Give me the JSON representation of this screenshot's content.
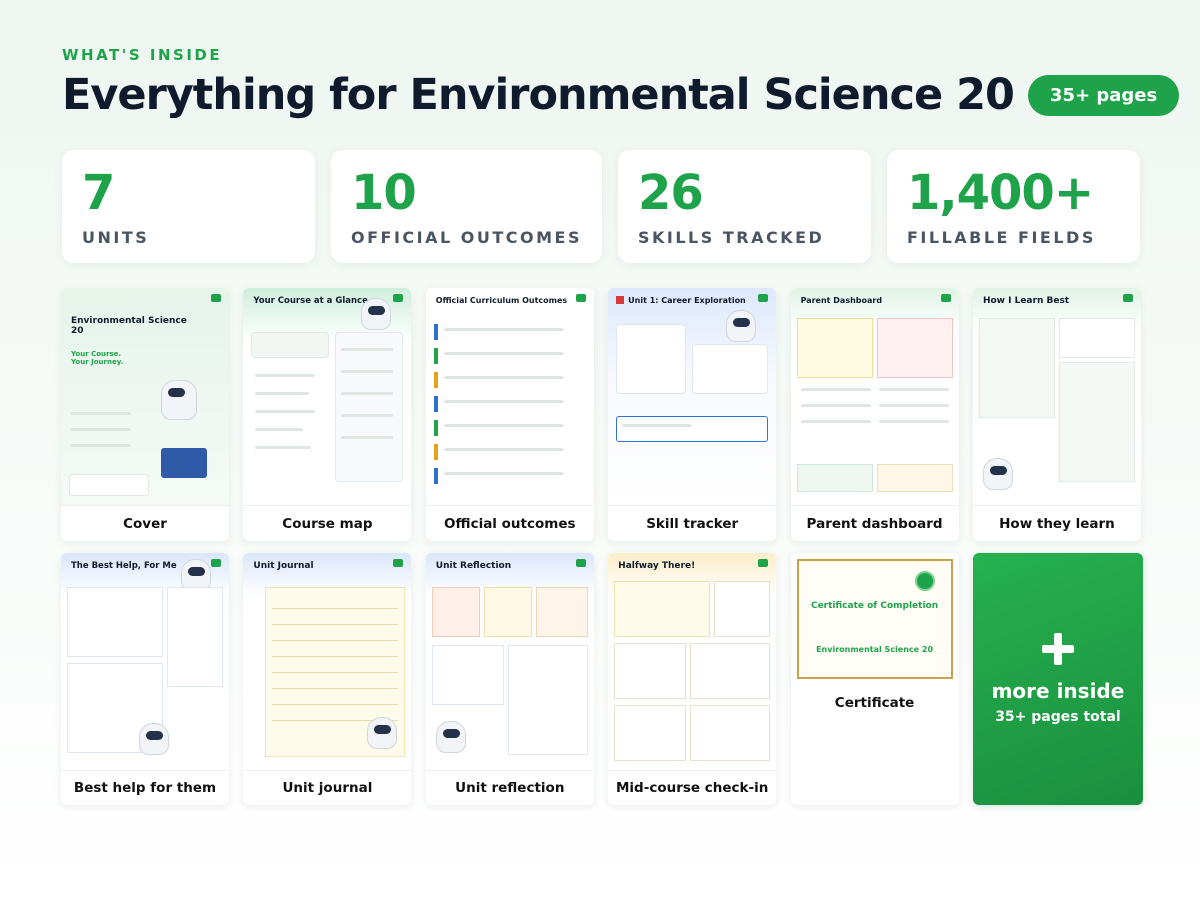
{
  "header": {
    "eyebrow": "WHAT'S INSIDE",
    "title": "Everything for Environmental Science 20",
    "pages_badge": "35+ pages"
  },
  "stats": [
    {
      "value": "7",
      "label": "UNITS"
    },
    {
      "value": "10",
      "label": "OFFICIAL OUTCOMES"
    },
    {
      "value": "26",
      "label": "SKILLS TRACKED"
    },
    {
      "value": "1,400+",
      "label": "FILLABLE FIELDS"
    }
  ],
  "cards": {
    "cover": {
      "label": "Cover",
      "thumb_title": "Environmental Science 20",
      "thumb_tagline": "Your Course. Your Journey."
    },
    "course_map": {
      "label": "Course map",
      "thumb_title": "Your Course at a Glance"
    },
    "outcomes": {
      "label": "Official outcomes",
      "thumb_title": "Official Curriculum Outcomes"
    },
    "skill_tracker": {
      "label": "Skill tracker",
      "thumb_title": "Unit 1: Career Exploration"
    },
    "parent_dashboard": {
      "label": "Parent dashboard",
      "thumb_title": "Parent Dashboard"
    },
    "how_they_learn": {
      "label": "How they learn",
      "thumb_title": "How I Learn Best"
    },
    "best_help": {
      "label": "Best help for them",
      "thumb_title": "The Best Help, For Me"
    },
    "unit_journal": {
      "label": "Unit journal",
      "thumb_title": "Unit Journal"
    },
    "unit_reflection": {
      "label": "Unit reflection",
      "thumb_title": "Unit Reflection"
    },
    "mid_course": {
      "label": "Mid-course check-in",
      "thumb_title": "Halfway There!"
    },
    "certificate": {
      "label": "Certificate",
      "thumb_title": "Certificate of Completion",
      "thumb_sub": "Environmental Science 20"
    }
  },
  "more": {
    "title": "more inside",
    "subtitle": "35+ pages total"
  },
  "colors": {
    "accent": "#1fa34a",
    "title": "#0f1b2d"
  }
}
